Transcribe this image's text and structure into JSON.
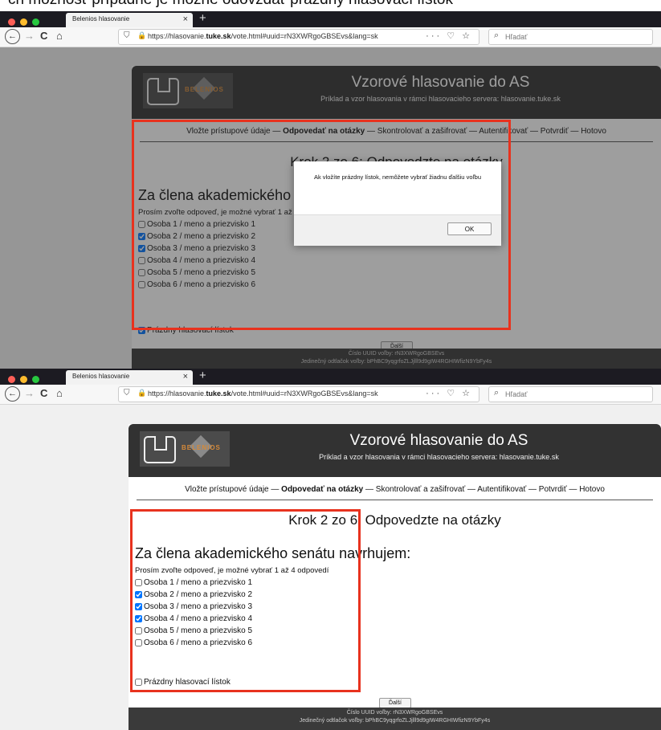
{
  "caption": "ch možnosť prípadne je možné odovzdať prázdny hlasovací lístok",
  "browser": {
    "tab_title": "Belenios hlasovanie",
    "tab_close": "×",
    "new_tab": "+",
    "back": "←",
    "forward": "→",
    "reload": "C",
    "home": "⌂",
    "url_prefix": "https://hlasovanie.",
    "url_domain": "tuke.sk",
    "url_suffix": "/vote.html#uuid=rN3XWRgoGBSEvs&lang=sk",
    "page_actions": "··· ♡ ☆",
    "search_placeholder": "Hľadať"
  },
  "page": {
    "logo_text": "BELENIOS",
    "title": "Vzorové hlasovanie do AS",
    "subtitle": "Príklad a vzor hlasovania v rámci hlasovacieho servera: hlasovanie.tuke.sk",
    "steps_before": "Vložte prístupové údaje — ",
    "steps_current": "Odpovedať na otázky",
    "steps_after": " — Skontrolovať a zašifrovať — Autentifikovať — Potvrdiť — Hotovo",
    "step_title": "Krok 2 zo 6: Odpovedzte na otázky",
    "question": "Za člena akademického senátu navrhujem:",
    "instruction": "Prosím zvoľte odpoveď, je možné vybrať 1 až 4 odpovedí",
    "answers": [
      "Osoba 1 / meno a priezvisko 1",
      "Osoba 2 / meno a priezvisko 2",
      "Osoba 3 / meno a priezvisko 3",
      "Osoba 4 / meno a priezvisko 4",
      "Osoba 5 / meno a priezvisko 5",
      "Osoba 6 / meno a priezvisko 6"
    ],
    "blank_label": "Prázdny hlasovací lístok",
    "next_label": "Ďalší",
    "footer_uuid": "Číslo UUID voľby: rN3XWRgoGBSEvs",
    "footer_fingerprint": "Jedinečný odtlačok voľby: bPhBC9yqgrfoZLJjlll9d9gIW4RGHIWfizN9YbFy4s"
  },
  "screenshot_1": {
    "checked": [
      false,
      true,
      true,
      false,
      false,
      false
    ],
    "blank_checked": true
  },
  "screenshot_2": {
    "checked": [
      false,
      true,
      true,
      true,
      false,
      false
    ],
    "blank_checked": false
  },
  "dialog": {
    "message": "Ak vložíte prázdny lístok, nemôžete vybrať žiadnu ďalšiu voľbu",
    "ok_label": "OK"
  },
  "colors": {
    "highlight": "#e8321e",
    "header_bg": "#323232",
    "tabbar_bg": "#1c1b22"
  }
}
